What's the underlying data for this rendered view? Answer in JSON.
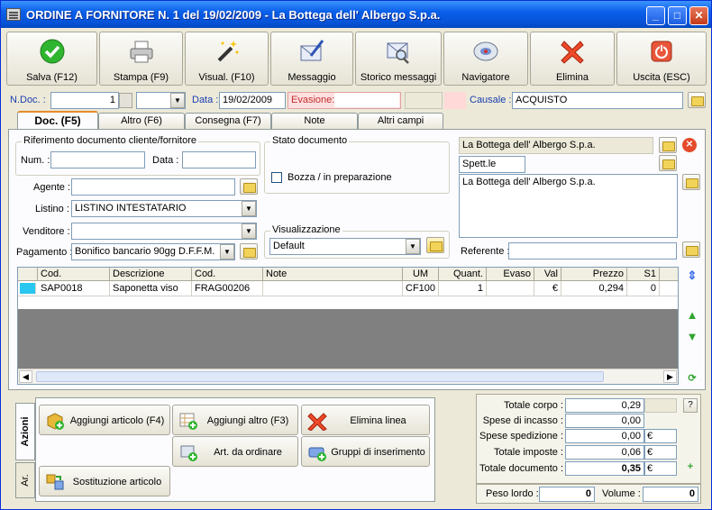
{
  "window": {
    "title": "ORDINE A FORNITORE N. 1  del 19/02/2009 - La Bottega dell' Albergo S.p.a."
  },
  "toolbar": [
    {
      "label": "Salva (F12)",
      "icon": "check-icon"
    },
    {
      "label": "Stampa (F9)",
      "icon": "printer-icon"
    },
    {
      "label": "Visual. (F10)",
      "icon": "magic-wand-icon"
    },
    {
      "label": "Messaggio",
      "icon": "envelope-pen-icon"
    },
    {
      "label": "Storico messaggi",
      "icon": "envelope-search-icon"
    },
    {
      "label": "Navigatore",
      "icon": "navigator-icon"
    },
    {
      "label": "Elimina",
      "icon": "delete-x-icon"
    },
    {
      "label": "Uscita (ESC)",
      "icon": "exit-icon"
    }
  ],
  "docstrip": {
    "ndoc_label": "N.Doc. :",
    "ndoc_value": "1",
    "data_label": "Data :",
    "data_value": "19/02/2009",
    "evasione_label": "Evasione:",
    "evasione_value": "",
    "causale_label": "Causale :",
    "causale_value": "ACQUISTO"
  },
  "tabs": [
    "Doc. (F5)",
    "Altro (F6)",
    "Consegna (F7)",
    "Note",
    "Altri campi"
  ],
  "rif": {
    "title": "Riferimento documento cliente/fornitore",
    "num_label": "Num. :",
    "num_value": "",
    "data_label": "Data :",
    "data_value": ""
  },
  "stato": {
    "title": "Stato documento",
    "bozza_label": "Bozza / in preparazione",
    "bozza_checked": false
  },
  "fields": {
    "agente_label": "Agente :",
    "agente_value": "",
    "listino_label": "Listino :",
    "listino_value": "LISTINO INTESTATARIO",
    "venditore_label": "Venditore :",
    "venditore_value": "",
    "pagamento_label": "Pagamento :",
    "pagamento_value": "Bonifico bancario 90gg D.F.F.M."
  },
  "visualizzazione": {
    "title": "Visualizzazione",
    "value": "Default"
  },
  "intestatario": {
    "name": "La Bottega dell' Albergo S.p.a.",
    "title_value": "Spett.le",
    "address": "La Bottega dell' Albergo S.p.a.",
    "referente_label": "Referente :",
    "referente_value": ""
  },
  "grid": {
    "columns": [
      "Cod.",
      "Descrizione",
      "Cod.",
      "Note",
      "UM",
      "Quant.",
      "Evaso",
      "Val",
      "Prezzo",
      "S1"
    ],
    "rows": [
      {
        "cod": "SAP0018",
        "descrizione": "Saponetta viso",
        "cod2": "FRAG00206",
        "note": "",
        "um": "CF100",
        "quant": "1",
        "evaso": "",
        "val": "€",
        "prezzo": "0,294",
        "s1": "0"
      }
    ]
  },
  "actions": {
    "tab_azioni": "Azioni",
    "tab_ar": "Ar.",
    "buttons": [
      {
        "label": "Aggiungi articolo (F4)",
        "icon": "add-article-icon"
      },
      {
        "label": "Aggiungi altro (F3)",
        "icon": "add-other-icon"
      },
      {
        "label": "Elimina linea",
        "icon": "delete-line-icon"
      },
      {
        "label": "Art. da ordinare",
        "icon": "order-article-icon"
      },
      {
        "label": "Gruppi di inserimento",
        "icon": "insert-group-icon"
      },
      {
        "label": "Sostituzione articolo",
        "icon": "replace-article-icon"
      }
    ]
  },
  "totals": {
    "totale_corpo_label": "Totale corpo :",
    "totale_corpo": "0,29",
    "spese_incasso_label": "Spese di incasso :",
    "spese_incasso": "0,00",
    "spese_spedizione_label": "Spese spedizione :",
    "spese_spedizione": "0,00",
    "spese_spedizione_cur": "€",
    "totale_imposte_label": "Totale imposte :",
    "totale_imposte": "0,06",
    "totale_imposte_cur": "€",
    "totale_documento_label": "Totale documento :",
    "totale_documento": "0,35",
    "totale_documento_cur": "€",
    "help": "?",
    "peso_label": "Peso lordo :",
    "peso_value": "0",
    "volume_label": "Volume :",
    "volume_value": "0"
  }
}
